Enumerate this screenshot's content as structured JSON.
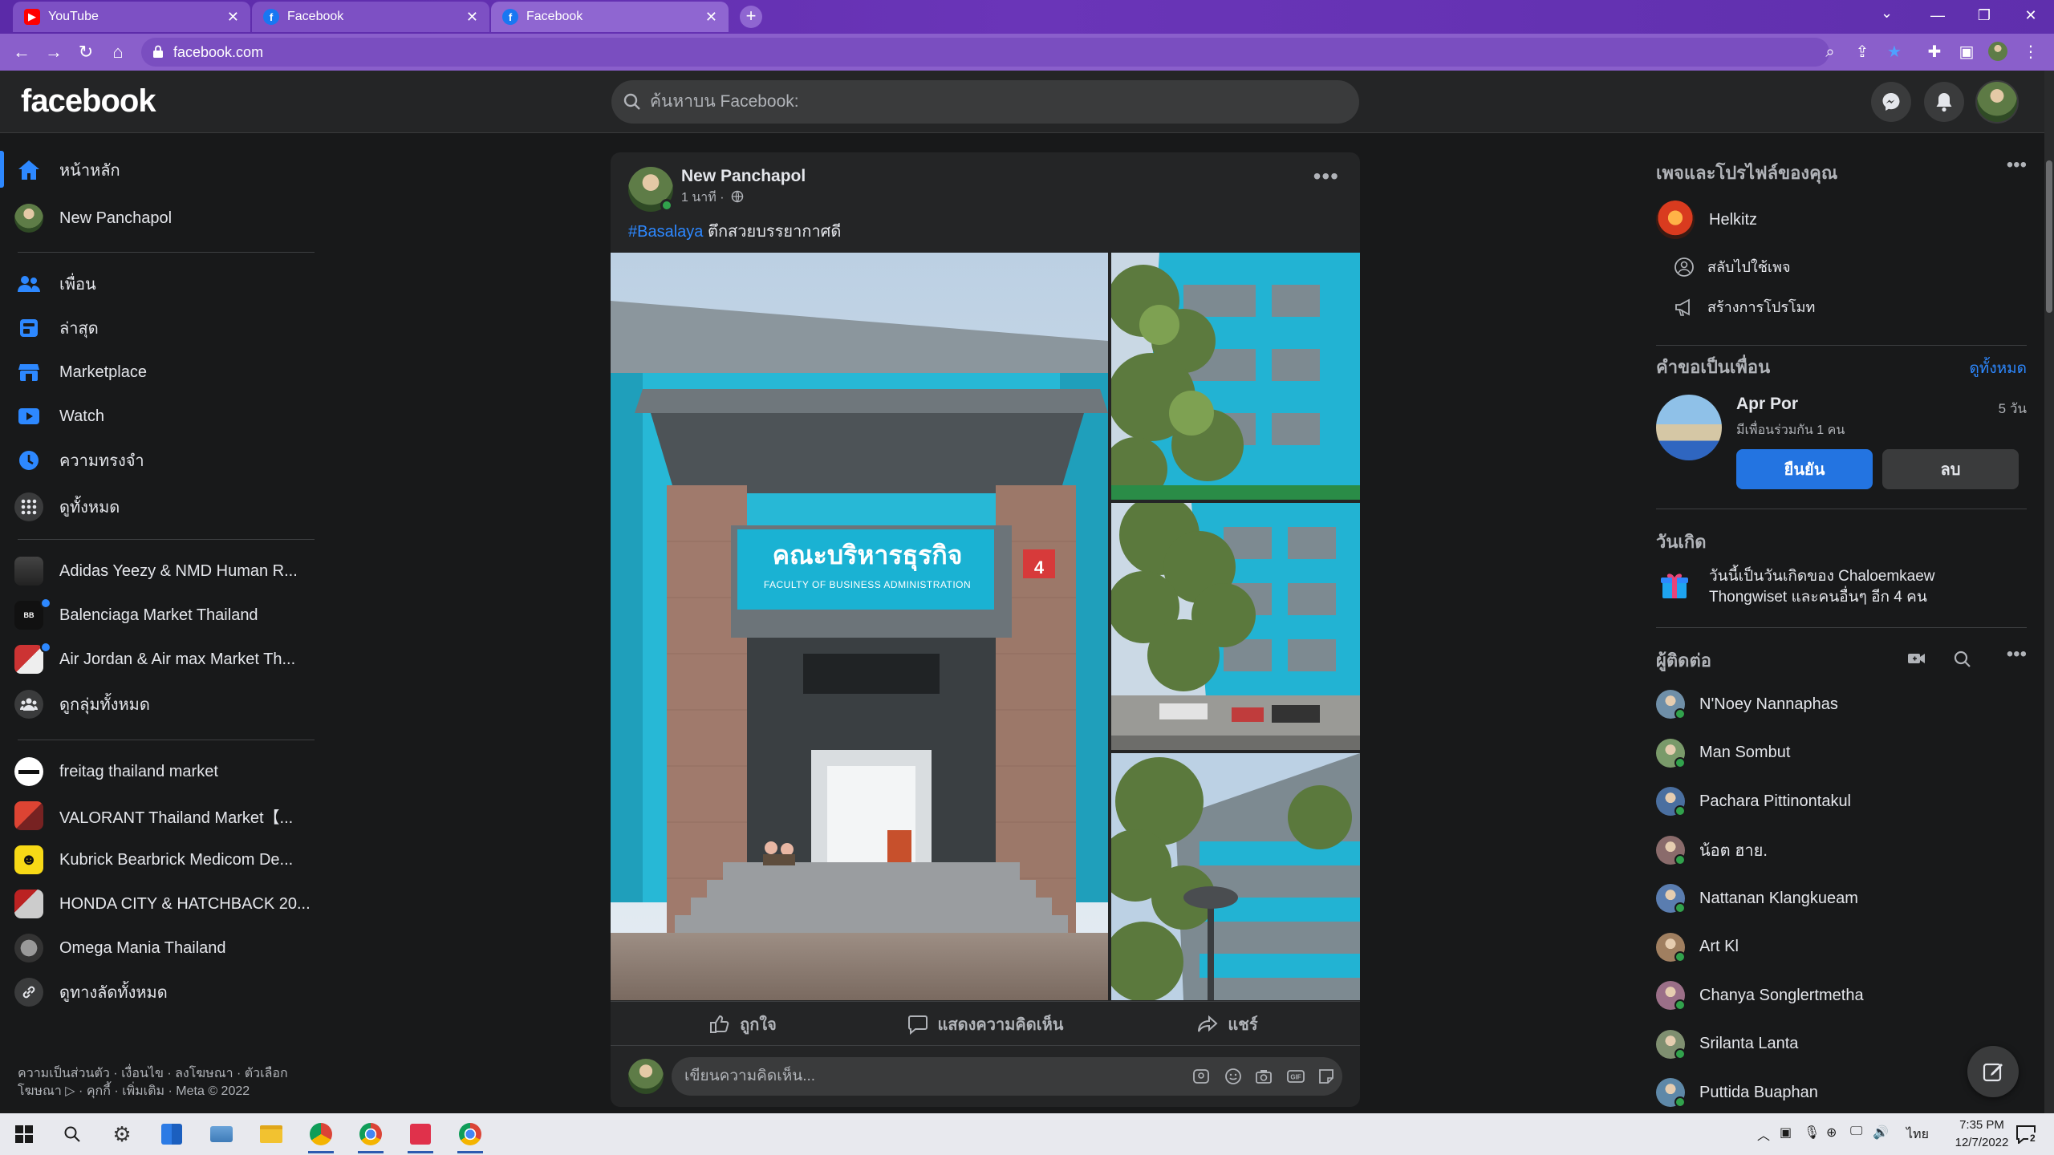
{
  "browser": {
    "tabs": [
      {
        "title": "YouTube",
        "icon": "youtube-icon",
        "active": false
      },
      {
        "title": "Facebook",
        "icon": "facebook-icon",
        "active": false
      },
      {
        "title": "Facebook",
        "icon": "facebook-icon",
        "active": true
      }
    ],
    "url": "facebook.com",
    "accent": "#6a35b8"
  },
  "fb": {
    "logo": "facebook",
    "search_placeholder": "ค้นหาบน Facebook:"
  },
  "left_nav": {
    "primary": [
      {
        "label": "หน้าหลัก",
        "icon": "home-icon"
      },
      {
        "label": "New Panchapol",
        "icon": "profile-avatar"
      }
    ],
    "secondary": [
      {
        "label": "เพื่อน",
        "icon": "friends-icon"
      },
      {
        "label": "ล่าสุด",
        "icon": "feeds-icon"
      },
      {
        "label": "Marketplace",
        "icon": "marketplace-icon"
      },
      {
        "label": "Watch",
        "icon": "watch-icon"
      },
      {
        "label": "ความทรงจำ",
        "icon": "memories-icon"
      },
      {
        "label": "ดูทั้งหมด",
        "icon": "grid-icon"
      }
    ],
    "groups": [
      {
        "label": "Adidas Yeezy & NMD Human R..."
      },
      {
        "label": "Balenciaga Market Thailand"
      },
      {
        "label": "Air Jordan & Air max Market Th..."
      },
      {
        "label": "ดูกลุ่มทั้งหมด"
      }
    ],
    "shortcuts": [
      {
        "label": "freitag thailand market"
      },
      {
        "label": "VALORANT Thailand Market【..."
      },
      {
        "label": "Kubrick Bearbrick Medicom De..."
      },
      {
        "label": "HONDA CITY & HATCHBACK 20..."
      },
      {
        "label": "Omega Mania Thailand"
      },
      {
        "label": "ดูทางลัดทั้งหมด"
      }
    ],
    "footer_line1": "ความเป็นส่วนตัว · เงื่อนไข · ลงโฆษณา · ตัวเลือก",
    "footer_line2": "โฆษณา ▷ · คุกกี้ · เพิ่มเติม · Meta © 2022"
  },
  "post": {
    "author": "New Panchapol",
    "time": "1 นาที ·",
    "hashtag": "#Basalaya",
    "text": " ตึกสวยบรรยากาศดี",
    "sign_th": "คณะบริหารธุรกิจ",
    "sign_en": "FACULTY OF BUSINESS ADMINISTRATION",
    "sign_number": "4",
    "like": "ถูกใจ",
    "comment": "แสดงความคิดเห็น",
    "share": "แชร์",
    "comment_placeholder": "เขียนความคิดเห็น..."
  },
  "right": {
    "pages_title": "เพจและโปรไฟล์ของคุณ",
    "page_name": "Helkitz",
    "switch_label": "สลับไปใช้เพจ",
    "promo_label": "สร้างการโปรโมท",
    "requests_title": "คำขอเป็นเพื่อน",
    "see_all": "ดูทั้งหมด",
    "request": {
      "name": "Apr Por",
      "age": "5 วัน",
      "mutual": "มีเพื่อนร่วมกัน 1 คน",
      "confirm": "ยืนยัน",
      "delete": "ลบ"
    },
    "birthdays_title": "วันเกิด",
    "birthday_text": "วันนี้เป็นวันเกิดของ Chaloemkaew Thongwiset และคนอื่นๆ อีก 4 คน",
    "contacts_title": "ผู้ติดต่อ",
    "contacts": [
      "N'Noey Nannaphas",
      "Man Sombut",
      "Pachara Pittinontakul",
      "น้อต ฮาย.",
      "Nattanan Klangkueam",
      "Art Kl",
      "Chanya Songlertmetha",
      "Srilanta Lanta",
      "Puttida Buaphan"
    ]
  },
  "taskbar": {
    "lang": "ไทย",
    "time": "7:35 PM",
    "date": "12/7/2022",
    "notif_count": "2"
  }
}
